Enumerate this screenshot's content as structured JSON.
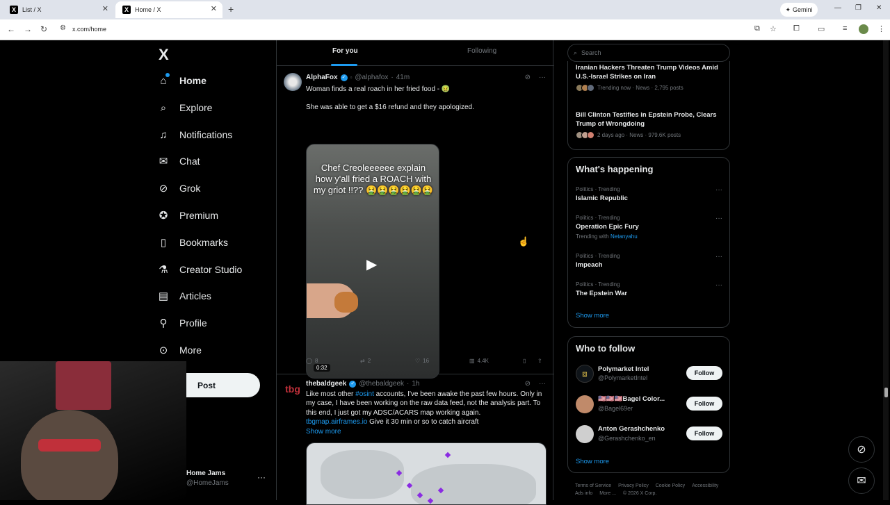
{
  "browser": {
    "tabs": [
      {
        "label": "List / X"
      },
      {
        "label": "Home / X"
      }
    ],
    "new_tab": "+",
    "gemini_label": "Gemini",
    "url": "x.com/home"
  },
  "nav": {
    "logo": "X",
    "items": [
      {
        "label": "Home",
        "icon": "home-icon"
      },
      {
        "label": "Explore",
        "icon": "search-icon"
      },
      {
        "label": "Notifications",
        "icon": "bell-icon"
      },
      {
        "label": "Chat",
        "icon": "mail-icon"
      },
      {
        "label": "Grok",
        "icon": "grok-icon"
      },
      {
        "label": "Premium",
        "icon": "verified-icon"
      },
      {
        "label": "Bookmarks",
        "icon": "bookmark-icon"
      },
      {
        "label": "Creator Studio",
        "icon": "flask-icon"
      },
      {
        "label": "Articles",
        "icon": "article-icon"
      },
      {
        "label": "Profile",
        "icon": "person-icon"
      },
      {
        "label": "More",
        "icon": "more-icon"
      }
    ],
    "post_label": "Post",
    "account_name": "Home Jams",
    "account_handle": "@HomeJams"
  },
  "feed": {
    "tabs": {
      "for_you": "For you",
      "following": "Following"
    },
    "tweet1": {
      "name": "AlphaFox",
      "handle": "@alphafox",
      "time": "41m",
      "text1": "Woman finds a real roach in her fried food - 🤢",
      "text2": "She was able to get a $16 refund and they apologized.",
      "video_caption": "Chef Creoleeeeee explain how y'all fried a ROACH with my griot !!?? 🤮🤮🤮🤮🤮🤮",
      "duration": "0:32",
      "replies": "8",
      "reposts": "2",
      "likes": "16",
      "views": "4.4K"
    },
    "tweet2": {
      "name": "thebaldgeek",
      "handle": "@thebaldgeek",
      "time": "1h",
      "text_before": "Like most other ",
      "hashtag": "#osint",
      "text_after": " accounts, I've been awake the past few hours. Only in my case, I have been working on the raw data feed, not the analysis part. To this end, I just got my ADSC/ACARS map working again.",
      "link": "tbgmap.airframes.io",
      "text_link_after": " Give it 30 min or so to catch aircraft",
      "show_more": "Show more"
    }
  },
  "sidebar": {
    "search_placeholder": "Search",
    "news": [
      {
        "title": "Iranian Hackers Threaten Trump Videos Amid U.S.-Israel Strikes on Iran",
        "meta": "Trending now · News · 2,795 posts"
      },
      {
        "title": "Bill Clinton Testifies in Epstein Probe, Clears Trump of Wrongdoing",
        "meta": "2 days ago · News · 979.6K posts"
      }
    ],
    "happening_title": "What's happening",
    "trends": [
      {
        "category": "Politics · Trending",
        "name": "Islamic Republic"
      },
      {
        "category": "Politics · Trending",
        "name": "Operation Epic Fury",
        "with_label": "Trending with",
        "with_link": "Netanyahu"
      },
      {
        "category": "Politics · Trending",
        "name": "Impeach"
      },
      {
        "category": "Politics · Trending",
        "name": "The Epstein War"
      }
    ],
    "show_more": "Show more",
    "wtf_title": "Who to follow",
    "wtf": [
      {
        "name": "Polymarket Intel",
        "handle": "@PolymarketIntel",
        "button": "Follow"
      },
      {
        "name": "🇺🇸🇺🇸🇺🇸Bagel Color...",
        "handle": "@Bagel69er",
        "button": "Follow"
      },
      {
        "name": "Anton Gerashchenko",
        "handle": "@Gerashchenko_en",
        "button": "Follow"
      }
    ],
    "wtf_show_more": "Show more",
    "footer": [
      "Terms of Service",
      "Privacy Policy",
      "Cookie Policy",
      "Accessibility",
      "Ads info",
      "More ...",
      "© 2026 X Corp."
    ]
  },
  "colors": {
    "accent": "#1d9bf0",
    "background": "#000000",
    "border": "#2f3336",
    "muted": "#71767b"
  }
}
